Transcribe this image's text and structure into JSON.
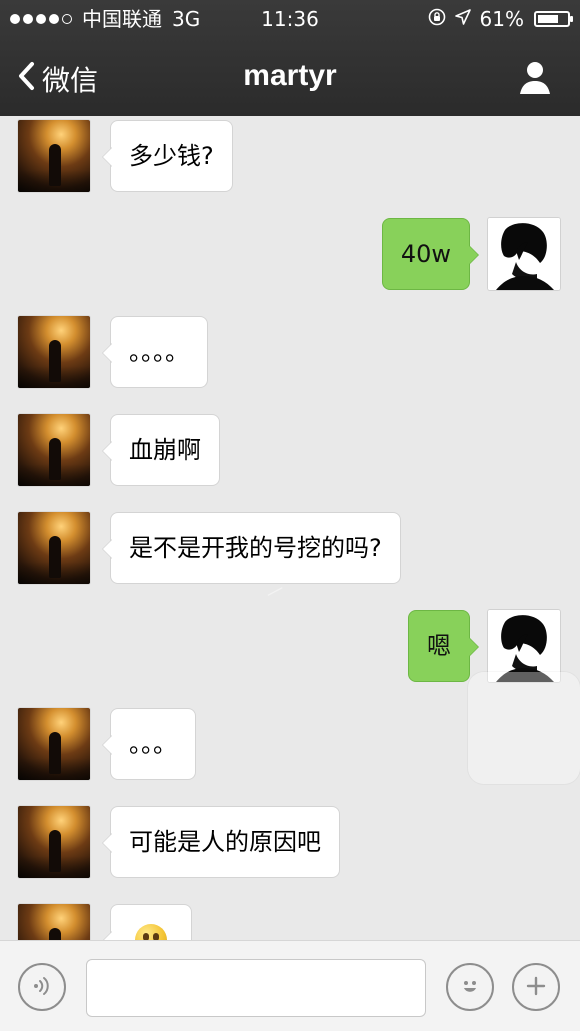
{
  "status_bar": {
    "carrier": "中国联通",
    "network": "3G",
    "time": "11:36",
    "battery_percent": "61%",
    "battery_level": 0.61
  },
  "nav": {
    "back_label": "微信",
    "title": "martyr"
  },
  "messages": [
    {
      "side": "left",
      "text": "多少钱?"
    },
    {
      "side": "right",
      "text": "40w"
    },
    {
      "side": "left",
      "text": "。。。。"
    },
    {
      "side": "left",
      "text": "血崩啊"
    },
    {
      "side": "left",
      "text": "是不是开我的号挖的吗?"
    },
    {
      "side": "right",
      "text": "嗯"
    },
    {
      "side": "left",
      "text": "。。。"
    },
    {
      "side": "left",
      "text": "可能是人的原因吧"
    },
    {
      "side": "left",
      "text": ""
    }
  ],
  "input_bar": {
    "placeholder": ""
  },
  "colors": {
    "header_bg": "#2f2f2f",
    "chat_bg": "#e9e9e9",
    "sent_bubble": "#88d15a",
    "received_bubble": "#ffffff"
  },
  "icons": {
    "back": "chevron-left-icon",
    "profile": "person-icon",
    "voice": "voice-icon",
    "emoji": "smile-icon",
    "plus": "plus-icon",
    "lock": "lock-icon",
    "location": "location-arrow-icon",
    "battery": "battery-icon"
  }
}
